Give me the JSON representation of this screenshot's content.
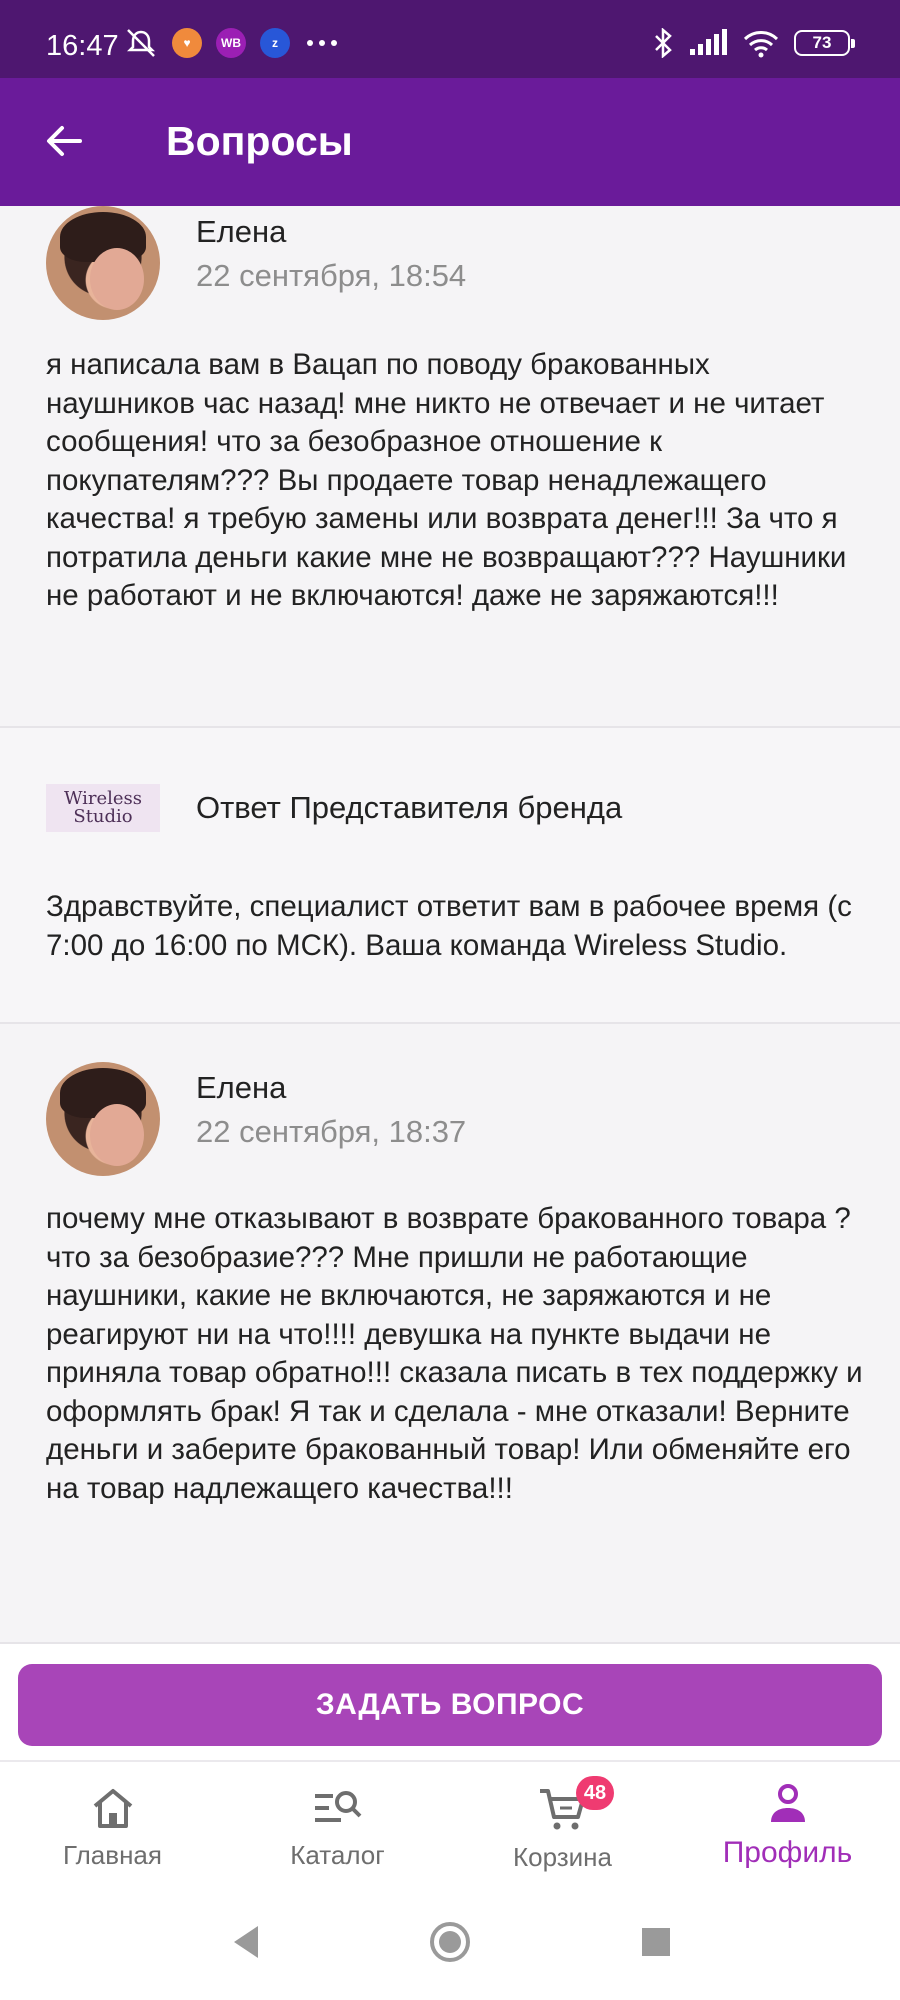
{
  "status_bar": {
    "time": "16:47",
    "left_icons": [
      "bell-off-icon",
      "heart-app-icon",
      "wb-app-icon",
      "zzzz-app-icon",
      "more-dots-icon"
    ],
    "wb_label": "WB",
    "battery": "73"
  },
  "app_bar": {
    "title": "Вопросы"
  },
  "questions": [
    {
      "author": "Елена",
      "date": "22 сентября, 18:54",
      "text": "я написала вам в Вацап по поводу бракованных наушников час назад! мне никто не отвечает и не читает сообщения! что за безобразное отношение к покупателям??? Вы продаете товар ненадлежащего качества! я требую замены или возврата денег!!! За что я потратила деньги какие мне не возвращают??? Наушники не работают и не включаются! даже не заряжаются!!!"
    },
    {
      "author": "Елена",
      "date": "22 сентября, 18:37",
      "text": "почему мне отказывают в возврате бракованного товара ? что за безобразие??? Мне пришли не работающие наушники, какие не включаются, не заряжаются и не реагируют ни на что!!!! девушка на пункте выдачи не приняла товар обратно!!! сказала писать в тех поддержку и оформлять брак! Я так и сделала - мне отказали! Верните деньги и заберите бракованный товар! Или обменяйте его на товар надлежащего качества!!!"
    }
  ],
  "answer": {
    "logo_line1": "Wireless",
    "logo_line2": "Studio",
    "title": "Ответ Представителя бренда",
    "text": "Здравствуйте, специалист ответит вам в рабочее время (с 7:00 до 16:00 по МСК). Ваша команда Wireless Studio."
  },
  "ask_button": "ЗАДАТЬ ВОПРОС",
  "bottom_nav": {
    "items": [
      {
        "label": "Главная",
        "icon": "home-icon"
      },
      {
        "label": "Каталог",
        "icon": "catalog-search-icon"
      },
      {
        "label": "Корзина",
        "icon": "cart-icon",
        "badge": "48"
      },
      {
        "label": "Профиль",
        "icon": "profile-icon",
        "active": true
      }
    ]
  },
  "colors": {
    "status_bar": "#4e1770",
    "app_bar": "#6a1b9a",
    "accent": "#a845b8",
    "badge": "#ef3b71"
  }
}
